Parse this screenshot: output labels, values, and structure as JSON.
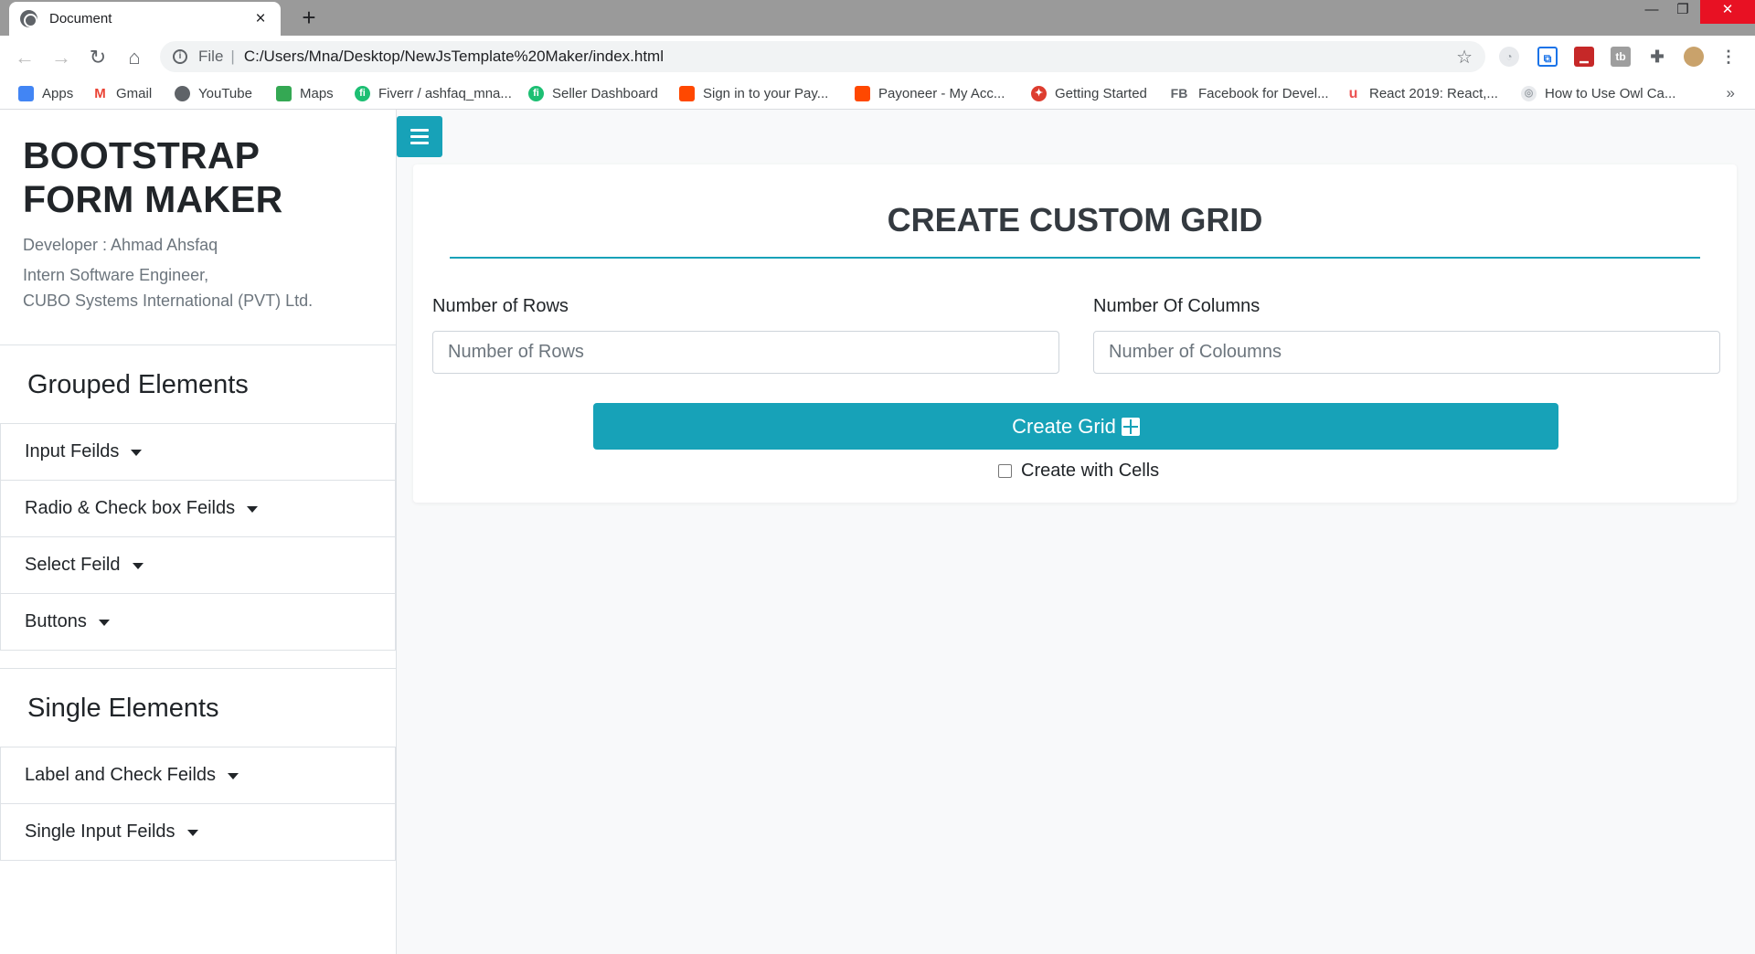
{
  "browser": {
    "tab_title": "Document",
    "new_tab": "+",
    "url_scheme": "File",
    "url": "C:/Users/Mna/Desktop/NewJsTemplate%20Maker/index.html",
    "bookmarks": [
      {
        "label": "Apps",
        "icon": "apps-grid-icon",
        "color": "#4285f4"
      },
      {
        "label": "Gmail",
        "icon": "gmail-icon",
        "color": "#ea4335"
      },
      {
        "label": "YouTube",
        "icon": "globe-icon",
        "color": "#5f6368"
      },
      {
        "label": "Maps",
        "icon": "maps-icon",
        "color": "#34a853"
      },
      {
        "label": "Fiverr / ashfaq_mna...",
        "icon": "fiverr-icon",
        "color": "#1dbf73"
      },
      {
        "label": "Seller Dashboard",
        "icon": "fiverr-icon",
        "color": "#1dbf73"
      },
      {
        "label": "Sign in to your Pay...",
        "icon": "payoneer-icon",
        "color": "#ff4800"
      },
      {
        "label": "Payoneer - My Acc...",
        "icon": "payoneer-icon",
        "color": "#ff4800"
      },
      {
        "label": "Getting Started",
        "icon": "angular-icon",
        "color": "#dd3d2f"
      },
      {
        "label": "Facebook for Devel...",
        "icon": "fb-text-icon",
        "color": "#5f6368"
      },
      {
        "label": "React 2019: React,...",
        "icon": "udemy-icon",
        "color": "#ec5252"
      },
      {
        "label": "How to Use Owl Ca...",
        "icon": "owl-icon",
        "color": "#9aa0a6"
      }
    ],
    "more": "»"
  },
  "sidebar": {
    "brand_title": "BOOTSTRAP FORM MAKER",
    "developer": "Developer : Ahmad Ahsfaq",
    "role": "Intern Software Engineer,",
    "company": "CUBO Systems International (PVT) Ltd.",
    "grouped_title": "Grouped Elements",
    "grouped_items": [
      "Input Feilds",
      "Radio & Check box Feilds",
      "Select Feild",
      "Buttons"
    ],
    "single_title": "Single Elements",
    "single_items": [
      "Label and Check Feilds",
      "Single Input Feilds"
    ]
  },
  "main": {
    "title": "CREATE CUSTOM GRID",
    "rows_label": "Number of Rows",
    "rows_placeholder": "Number of Rows",
    "cols_label": "Number Of Columns",
    "cols_placeholder": "Number of Coloumns",
    "create_label": "Create Grid",
    "checkbox_label": "Create with Cells",
    "accent_color": "#17a2b8"
  }
}
